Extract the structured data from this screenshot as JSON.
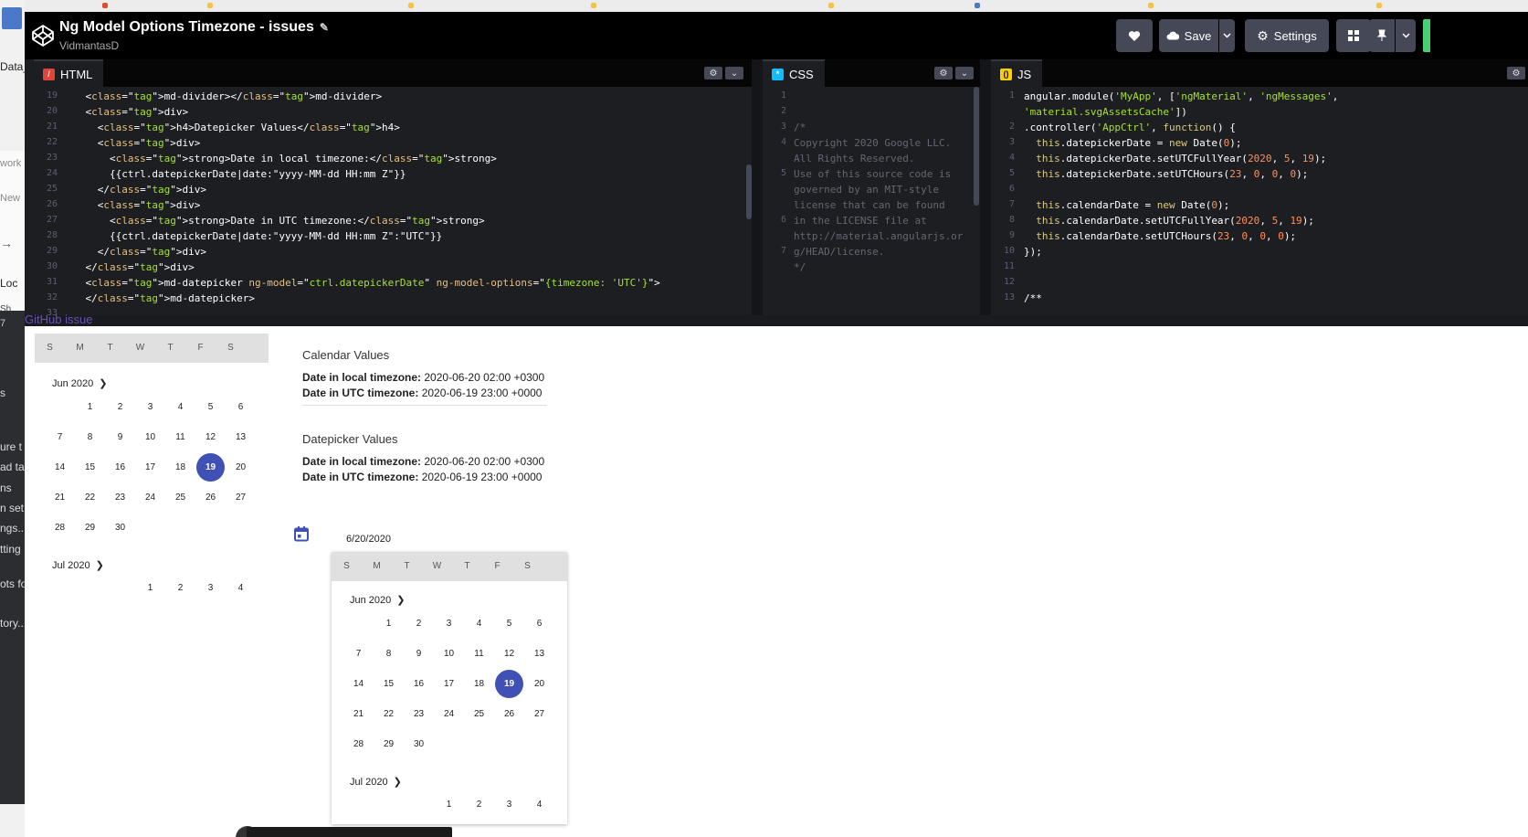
{
  "desktop": {
    "slivers": [
      "Data_",
      "work",
      "New",
      "→",
      "Loc",
      "Sh",
      "7",
      "s",
      "ure t",
      "ad ta",
      "ns",
      "n set",
      "ngs...",
      "tting",
      "ots fo",
      "tory..."
    ]
  },
  "header": {
    "title": "Ng Model Options Timezone - issues",
    "author": "VidmantasD",
    "save_label": "Save",
    "settings_label": "Settings"
  },
  "editors": {
    "html": {
      "label": "HTML",
      "line_numbers": [
        "19",
        "20",
        "21",
        "22",
        "23",
        "24",
        "25",
        "26",
        "27",
        "28",
        "29",
        "30",
        "31",
        "32",
        "33"
      ],
      "lines": [
        "    <md-divider></md-divider>",
        "    <div>",
        "      <h4>Datepicker Values</h4>",
        "      <div>",
        "        <strong>Date in local timezone:</strong>",
        "        {{ctrl.datepickerDate|date:\"yyyy-MM-dd HH:mm Z\"}}",
        "      </div>",
        "      <div>",
        "        <strong>Date in UTC timezone:</strong>",
        "        {{ctrl.datepickerDate|date:\"yyyy-MM-dd HH:mm Z\":\"UTC\"}}",
        "      </div>",
        "    </div>",
        "    <md-datepicker ng-model=\"ctrl.datepickerDate\" ng-model-options=\"{timezone: 'UTC'}\">",
        "    </md-datepicker>",
        ""
      ]
    },
    "css": {
      "label": "CSS",
      "line_numbers": [
        "1",
        "2",
        "3",
        "4",
        "",
        "5",
        "",
        "",
        "6",
        "",
        "7"
      ],
      "lines": [
        "",
        "",
        "/*",
        "Copyright 2020 Google LLC.",
        "All Rights Reserved.",
        "Use of this source code is",
        "governed by an MIT-style",
        "license that can be found",
        "in the LICENSE file at",
        "http://material.angularjs.or",
        "g/HEAD/license.",
        "*/"
      ]
    },
    "js": {
      "label": "JS",
      "line_numbers": [
        "1",
        "",
        "2",
        "3",
        "4",
        "5",
        "6",
        "7",
        "8",
        "9",
        "10",
        "11",
        "12",
        "13"
      ],
      "lines": [
        "angular.module('MyApp', ['ngMaterial', 'ngMessages',",
        "'material.svgAssetsCache'])",
        ".controller('AppCtrl', function() {",
        "  this.datepickerDate = new Date(0);",
        "  this.datepickerDate.setUTCFullYear(2020, 5, 19);",
        "  this.datepickerDate.setUTCHours(23, 0, 0, 0);",
        "",
        "  this.calendarDate = new Date(0);",
        "  this.calendarDate.setUTCFullYear(2020, 5, 19);",
        "  this.calendarDate.setUTCHours(23, 0, 0, 0);",
        "});",
        "",
        "",
        "/**"
      ]
    }
  },
  "preview": {
    "github_link": "GitHub issue",
    "weekdays": [
      "S",
      "M",
      "T",
      "W",
      "T",
      "F",
      "S"
    ],
    "month_label": "Jun 2020",
    "next_month_label": "Jul 2020",
    "june_days": [
      "1",
      "2",
      "3",
      "4",
      "5",
      "6",
      "7",
      "8",
      "9",
      "10",
      "11",
      "12",
      "13",
      "14",
      "15",
      "16",
      "17",
      "18",
      "19",
      "20",
      "21",
      "22",
      "23",
      "24",
      "25",
      "26",
      "27",
      "28",
      "29",
      "30"
    ],
    "june_start_col": 1,
    "selected_day": "19",
    "july_days": [
      "1",
      "2",
      "3",
      "4"
    ],
    "calendar_values": {
      "heading": "Calendar Values",
      "local_label": "Date in local timezone:",
      "local_value": "2020-06-20 02:00 +0300",
      "utc_label": "Date in UTC timezone:",
      "utc_value": "2020-06-19 23:00 +0000"
    },
    "datepicker_values": {
      "heading": "Datepicker Values",
      "local_label": "Date in local timezone:",
      "local_value": "2020-06-20 02:00 +0300",
      "utc_label": "Date in UTC timezone:",
      "utc_value": "2020-06-19 23:00 +0000"
    },
    "datepicker_input": "6/20/2020"
  }
}
